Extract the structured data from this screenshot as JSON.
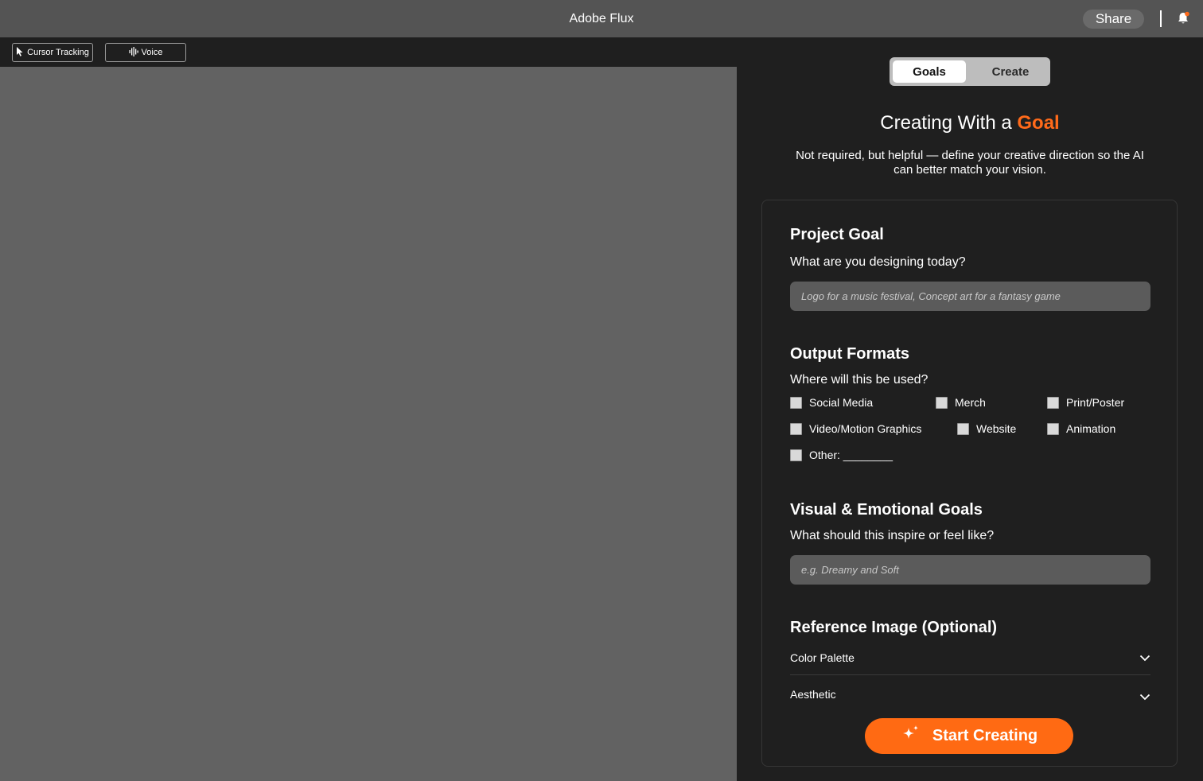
{
  "titlebar": {
    "title": "Adobe Flux",
    "share_label": "Share",
    "notification_badge_color": "#ff6a1a",
    "bell_icon": "bell-icon"
  },
  "toolbar": {
    "cursor_tracking_label": "Cursor Tracking",
    "cursor_icon": "cursor-arrow-icon",
    "voice_label": "Voice",
    "voice_icon": "waveform-icon"
  },
  "panel": {
    "tabs": [
      {
        "label": "Goals",
        "active": true
      },
      {
        "label": "Create",
        "active": false
      }
    ],
    "heading_prefix": "Creating With a ",
    "heading_accent": "Goal",
    "accent_color": "#ff6a1a",
    "subtext": "Not required, but helpful — define your creative direction so the AI can better match your vision.",
    "project_goal": {
      "title": "Project Goal",
      "question": "What are you designing today?",
      "placeholder": "Logo for a music festival, Concept art for a fantasy game",
      "value": ""
    },
    "output_formats": {
      "title": "Output Formats",
      "question": "Where will this be used?",
      "options": [
        {
          "label": "Social Media",
          "checked": false
        },
        {
          "label": "Merch",
          "checked": false
        },
        {
          "label": "Print/Poster",
          "checked": false
        },
        {
          "label": "Video/Motion Graphics",
          "checked": false
        },
        {
          "label": "Website",
          "checked": false
        },
        {
          "label": "Animation",
          "checked": false
        },
        {
          "label": "Other: ________",
          "checked": false
        }
      ]
    },
    "visual_goals": {
      "title": "Visual & Emotional Goals",
      "question": "What should this inspire or feel like?",
      "placeholder": "e.g. Dreamy and Soft",
      "value": ""
    },
    "reference": {
      "title": "Reference Image (Optional)",
      "accordions": [
        {
          "label": "Color Palette",
          "icon": "chevron-down-icon"
        },
        {
          "label": "Aesthetic",
          "icon": "chevron-down-icon"
        }
      ]
    },
    "start_button": {
      "label": "Start Creating",
      "icon": "sparkle-icon",
      "color": "#ff6a13"
    }
  }
}
